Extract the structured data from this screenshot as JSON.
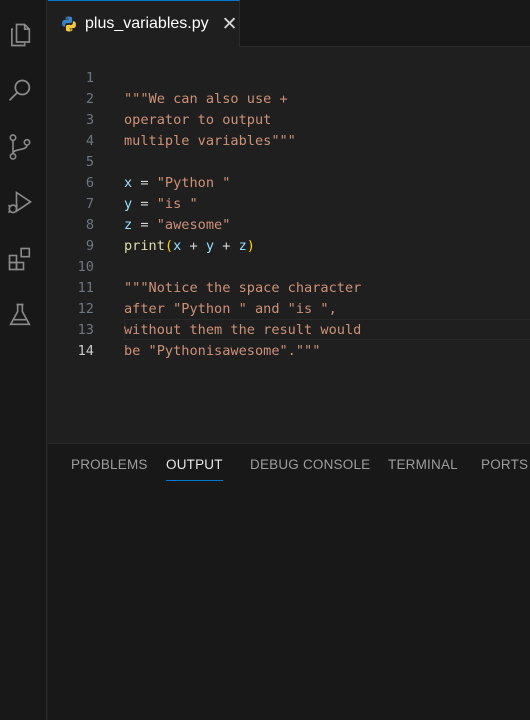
{
  "activity_bar": {
    "icons": [
      "files-icon",
      "search-icon",
      "source-control-icon",
      "run-debug-icon",
      "extensions-icon",
      "testing-icon"
    ]
  },
  "tab": {
    "filename": "plus_variables.py",
    "close_glyph": "✕"
  },
  "editor": {
    "current_line": 14,
    "line_numbers": [
      "1",
      "2",
      "3",
      "4",
      "5",
      "6",
      "7",
      "8",
      "9",
      "10",
      "11",
      "12",
      "13",
      "14"
    ],
    "lines": [
      "\"\"\"We can also use +",
      "operator to output",
      "multiple variables\"\"\"",
      "",
      "x = \"Python \"",
      "y = \"is \"",
      "z = \"awesome\"",
      "print(x + y + z)",
      "",
      "\"\"\"Notice the space character",
      "after \"Python \" and \"is \",",
      "without them the result would",
      "be \"Pythonisawesome\".\"\"\"",
      ""
    ]
  },
  "panel": {
    "tabs": [
      "PROBLEMS",
      "OUTPUT",
      "DEBUG CONSOLE",
      "TERMINAL",
      "PORTS"
    ],
    "active_tab": "OUTPUT"
  },
  "colors": {
    "accent": "#0078d4",
    "string": "#ce9178",
    "variable": "#9cdcfe",
    "function": "#dcdcaa",
    "paren": "#ffd700"
  }
}
